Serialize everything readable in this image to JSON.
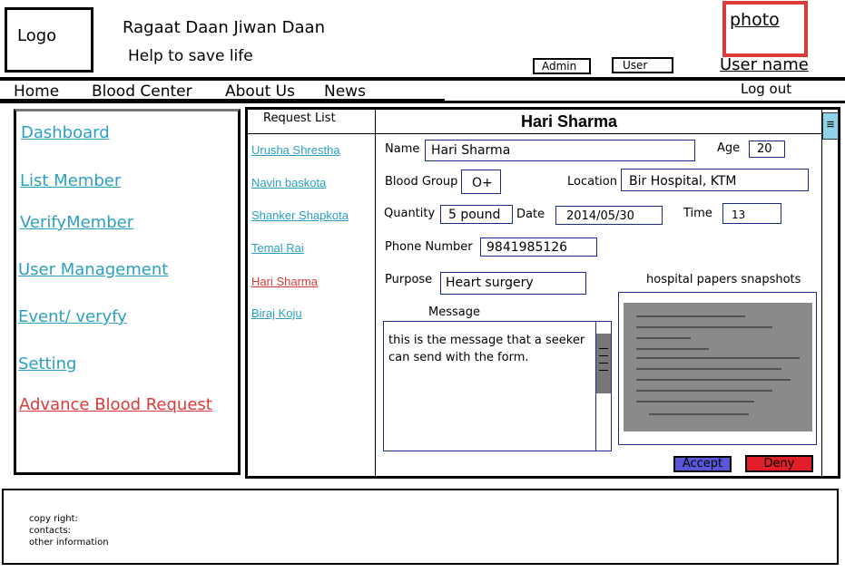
{
  "header": {
    "logo": "Logo",
    "title": "Ragaat Daan Jiwan Daan",
    "tagline": "Help to save life",
    "photo": "photo",
    "admin_label": "Admin",
    "user_label": "User",
    "user_name": "User name",
    "logout": "Log out"
  },
  "nav": {
    "home": "Home",
    "blood_center": "Blood Center",
    "about_us": "About Us",
    "news": "News"
  },
  "sidebar": {
    "items": [
      {
        "label": "Dashboard"
      },
      {
        "label": "List Member"
      },
      {
        "label": "VerifyMember"
      },
      {
        "label": "User Management"
      },
      {
        "label": "Event/ veryfy"
      },
      {
        "label": "Setting"
      },
      {
        "label": "Advance Blood Request"
      }
    ]
  },
  "request_list": {
    "header": "Request List",
    "items": [
      {
        "name": "Urusha Shrestha"
      },
      {
        "name": "Navin baskota"
      },
      {
        "name": "Shanker Shapkota"
      },
      {
        "name": "Temal Rai"
      },
      {
        "name": "Hari Sharma"
      },
      {
        "name": "Biraj Koju"
      }
    ]
  },
  "detail": {
    "title": "Hari Sharma",
    "name_label": "Name",
    "name_value": "Hari Sharma",
    "age_label": "Age",
    "age_value": "20",
    "blood_group_label": "Blood Group",
    "blood_group_value": "O+",
    "location_label": "Location",
    "location_value": "Bir Hospital, KTM",
    "quantity_label": "Quantity",
    "quantity_value": "5 pound",
    "date_label": "Date",
    "date_value": "2014/05/30",
    "time_label": "Time",
    "time_value": "13",
    "phone_label": "Phone Number",
    "phone_value": "9841985126",
    "purpose_label": "Purpose",
    "purpose_value": "Heart surgery",
    "message_label": "Message",
    "message_value": "this is the message that a seeker can send with the form.",
    "papers_label": "hospital  papers snapshots",
    "accept_label": "Accept",
    "deny_label": "Deny"
  },
  "footer": {
    "copyright": "copy right:",
    "contacts": "contacts:",
    "other": "other information"
  },
  "icons": {
    "scroll_thumb": "menu-grip-icon"
  },
  "colors": {
    "link": "#2a9fc3",
    "active": "#d93a3a",
    "accept": "#5a58d8",
    "deny": "#e11f2a"
  }
}
